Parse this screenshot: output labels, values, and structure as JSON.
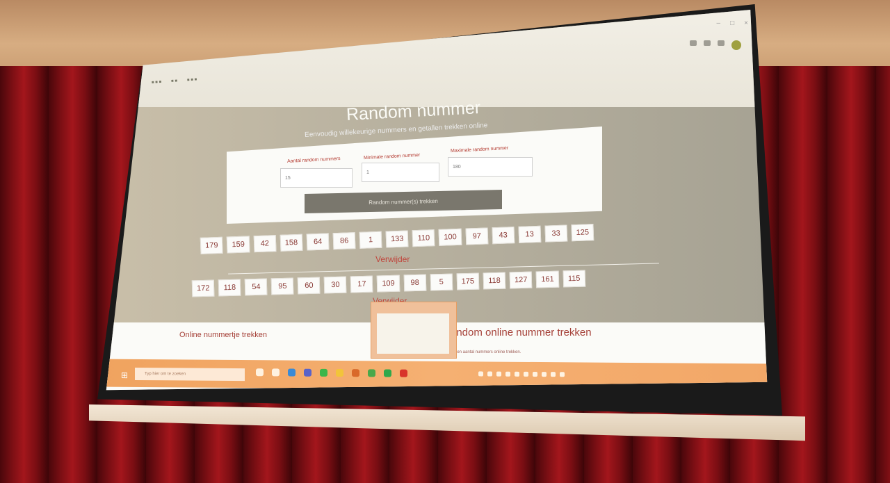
{
  "page": {
    "title": "Random nummer",
    "subtitle": "Eenvoudig willekeurige nummers en getallen trekken online"
  },
  "form": {
    "count_label": "Aantal random nummers",
    "count_value": "15",
    "min_label": "Minimale random nummer",
    "min_value": "1",
    "max_label": "Maximale random nummer",
    "max_value": "180",
    "generate_label": "Random nummer(s) trekken"
  },
  "results": {
    "row1": [
      "179",
      "159",
      "42",
      "158",
      "64",
      "86",
      "1",
      "133",
      "110",
      "100",
      "97",
      "43",
      "13",
      "33",
      "125"
    ],
    "row2": [
      "172",
      "118",
      "54",
      "95",
      "60",
      "30",
      "17",
      "109",
      "98",
      "5",
      "175",
      "118",
      "127",
      "161",
      "115"
    ],
    "remove_label_1": "Verwijder",
    "remove_label_2": "Verwijder"
  },
  "sections": {
    "left_title": "Online nummertje trekken",
    "right_title": "andom online nummer trekken",
    "right_text": "een aantal nummers online trekken."
  },
  "taskbar": {
    "search_placeholder": "Typ hier om te zoeken"
  },
  "colors": {
    "accent": "#b33a30",
    "taskbar": "#f2a767",
    "button": "#7a776d"
  }
}
